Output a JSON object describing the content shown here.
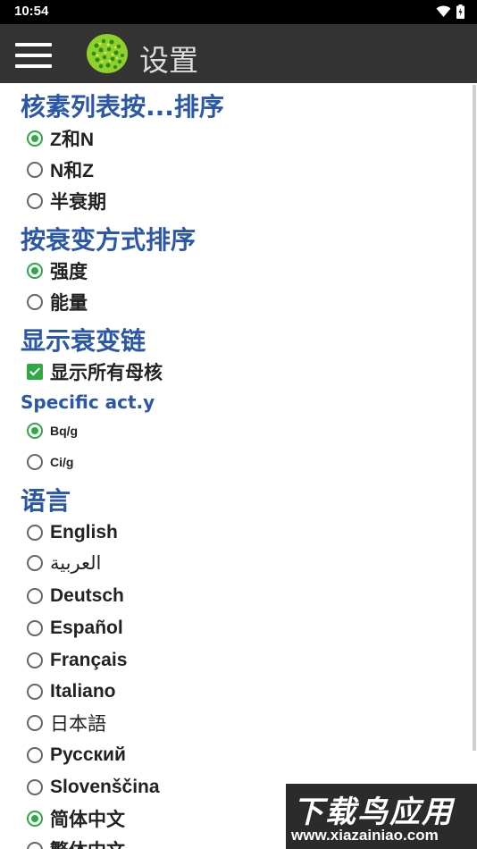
{
  "status": {
    "time": "10:54"
  },
  "appbar": {
    "title": "设置"
  },
  "sections": {
    "sort_nuclide": "核素列表按...排序",
    "sort_decay": "按衰变方式排序",
    "show_chain": "显示衰变链",
    "specific_act": "Specific act.y",
    "language": "语言"
  },
  "options": {
    "zn": "Z和N",
    "nz": "N和Z",
    "halflife": "半衰期",
    "intensity": "强度",
    "energy": "能量",
    "show_parents": "显示所有母核",
    "bqg": "Bq/g",
    "cig": "Ci/g"
  },
  "languages": [
    "English",
    "العربية",
    "Deutsch",
    "Español",
    "Français",
    "Italiano",
    "日本語",
    "Русский",
    "Slovenščina",
    "简体中文",
    "繁体中文"
  ],
  "watermark": {
    "line1": "下载鸟应用",
    "line2": "www.xiazainiao.com"
  },
  "colors": {
    "accent": "#2eaa44",
    "section": "#2a57a8",
    "appbar": "#333333"
  }
}
